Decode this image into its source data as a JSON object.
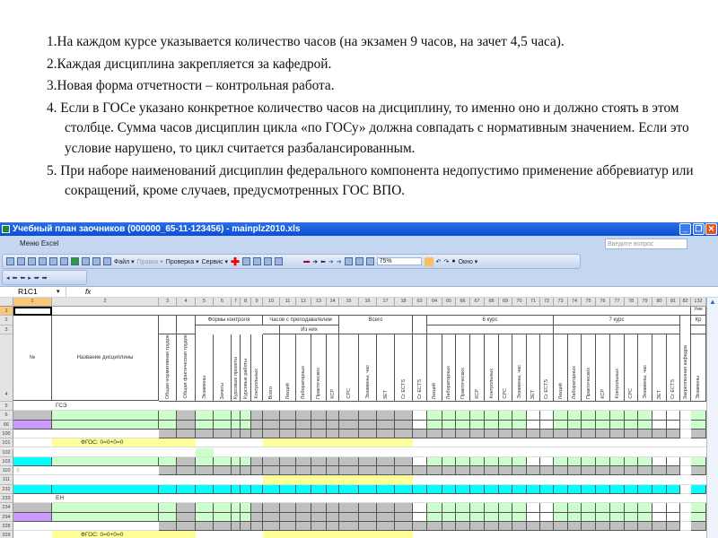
{
  "notes": [
    "1.На каждом курсе указывается количество часов (на экзамен 9 часов, на зачет 4,5 часа).",
    "2.Каждая дисциплина закрепляется за кафедрой.",
    "3.Новая форма отчетности – контрольная работа.",
    "4. Если в ГОСе указано конкретное количество часов на дисциплину, то именно оно и должно стоять в этом столбце. Сумма часов дисциплин цикла «по ГОСу» должна совпадать с нормативным значением. Если это условие нарушено, то цикл считается разбалансированным.",
    "5. При наборе наименований дисциплин федерального компонента недопустимо применение аббревиатур или сокращений, кроме случаев, предусмотренных ГОС ВПО."
  ],
  "window": {
    "title": "Учебный план заочников (000000_65-11-123456) - mainplz2010.xls",
    "ask_placeholder": "Введите вопрос",
    "menu_item": "Меню Excel"
  },
  "toolbar": {
    "file": "Файл ▾",
    "edit": "Правка ▾",
    "check": "Проверка ▾",
    "service": "Сервис ▾",
    "zoom": "75%",
    "window": "Окно ▾"
  },
  "formula_bar": {
    "name_box": "R1C1",
    "fx": "fx"
  },
  "columns": [
    "1",
    "2",
    "3",
    "4",
    "5",
    "6",
    "7",
    "8",
    "9",
    "10",
    "11",
    "12",
    "13",
    "14",
    "15",
    "16",
    "17",
    "18",
    "63",
    "64",
    "65",
    "66",
    "67",
    "68",
    "69",
    "70",
    "71",
    "72",
    "73",
    "74",
    "75",
    "76",
    "77",
    "78",
    "79",
    "80",
    "81",
    "82",
    "132"
  ],
  "header": {
    "no": "№",
    "name": "Название дисциплины",
    "forms": "Формы контроля",
    "contact": "Часов с преподавателем",
    "of_them": "Из них",
    "total": "Всего",
    "course6": "6 курс",
    "course7": "7 курс",
    "row1_last": "Уме",
    "row2_last": "Кр",
    "vertical": [
      "Общая нормативная трудоемкость, час",
      "Общая фактическая трудоемкость, час",
      "Экзамены",
      "Зачеты",
      "Курсовые проекты",
      "Курсовые работы",
      "Контрольных",
      "Всего",
      "Лекций",
      "Лабораторных",
      "Практических",
      "КСР",
      "СРС",
      "Экзамены, час",
      "ЗЕТ",
      "Cr ECTS",
      "Cr ECTS",
      "Лекций",
      "Лабораторных",
      "Практических",
      "КСР",
      "Контрольных",
      "СРС",
      "Экзамены, час",
      "ЗЕТ",
      "Cr ECTS",
      "Лекций",
      "Лабораторных",
      "Практических",
      "КСР",
      "Контрольных",
      "СРС",
      "Экзамены, час",
      "ЗЕТ",
      "Cr ECTS",
      "Закрепленная кафедра",
      "Экзамены"
    ]
  },
  "rows": [
    {
      "n": "5",
      "type": "section",
      "label": "ГСЭ"
    },
    {
      "n": "6",
      "type": "disc",
      "first": "g"
    },
    {
      "n": "66",
      "type": "disc",
      "first": "pu"
    },
    {
      "n": "100",
      "type": "gray"
    },
    {
      "n": "101",
      "type": "fgos",
      "label": "ФГОС: 0=0+0=0"
    },
    {
      "n": "102",
      "type": "blank"
    },
    {
      "n": "103",
      "type": "disc",
      "first": "cy"
    },
    {
      "n": "110",
      "type": "gray",
      "label": "3"
    },
    {
      "n": "111",
      "type": "y2"
    },
    {
      "n": "232",
      "type": "cyan"
    },
    {
      "n": "233",
      "type": "section",
      "label": "ЕН"
    },
    {
      "n": "234",
      "type": "disc",
      "first": "g"
    },
    {
      "n": "294",
      "type": "disc",
      "first": "pu"
    },
    {
      "n": "328",
      "type": "gray"
    },
    {
      "n": "329",
      "type": "fgos",
      "label": "ФГОС: 0=0+0=0"
    }
  ]
}
